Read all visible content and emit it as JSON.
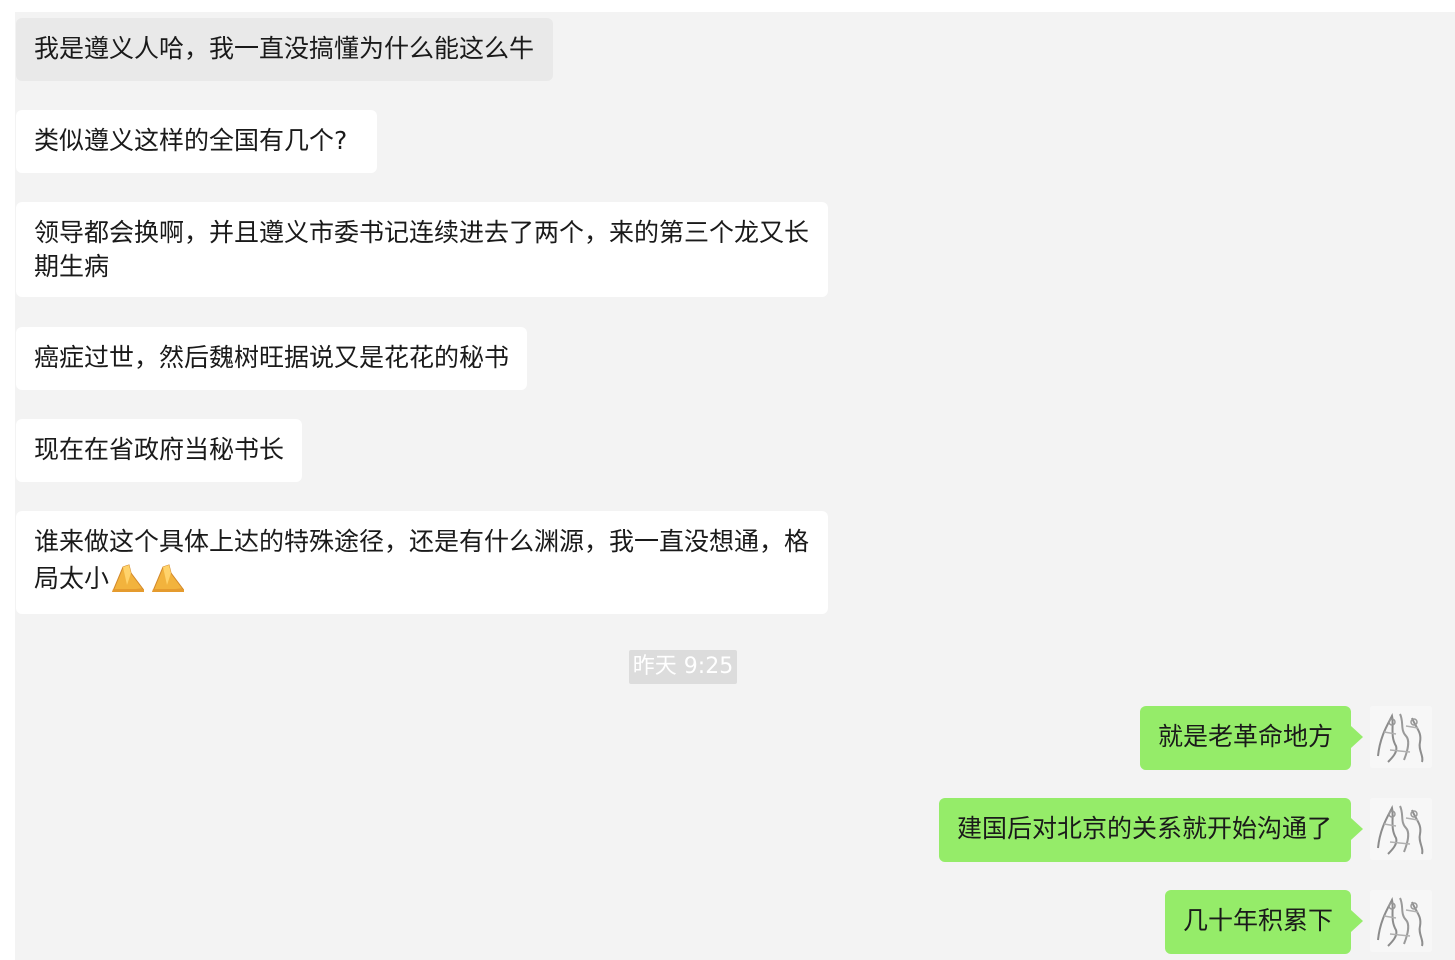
{
  "messages_incoming": [
    {
      "text": "我是遵义人哈，我一直没搞懂为什么能这么牛"
    },
    {
      "text": "类似遵义这样的全国有几个?"
    },
    {
      "text": "领导都会换啊，并且遵义市委书记连续进去了两个，来的第三个龙又长期生病"
    },
    {
      "text": "癌症过世，然后魏树旺据说又是花花的秘书"
    },
    {
      "text": "现在在省政府当秘书长"
    },
    {
      "text": "谁来做这个具体上达的特殊途径，还是有什么渊源，我一直没想通，格局太小",
      "emoji": "🙏🙏"
    }
  ],
  "timestamp": "昨天 9:25",
  "messages_outgoing": [
    {
      "text": "就是老革命地方"
    },
    {
      "text": "建国后对北京的关系就开始沟通了"
    },
    {
      "text": "几十年积累下"
    }
  ],
  "colors": {
    "chat_background": "#f3f3f3",
    "incoming_bubble": "#ffffff",
    "outgoing_bubble": "#95ec69",
    "timestamp_bg": "#dcdcdc"
  },
  "icons": {
    "avatar": "sketch-avatar-icon",
    "emoji": "praying-hands-emoji"
  }
}
